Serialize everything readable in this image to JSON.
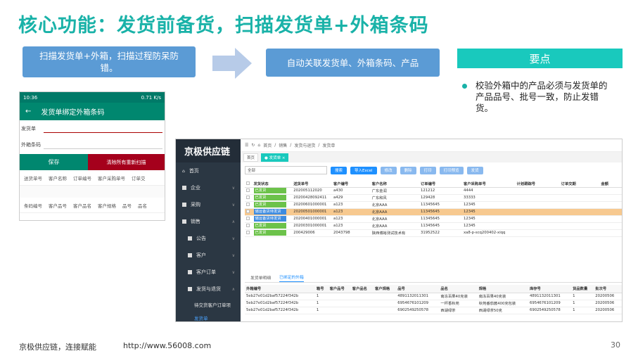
{
  "slide": {
    "title": "核心功能：发货前备货，扫描发货单+外箱条码",
    "step1": "扫描发货单+外箱，扫描过程防呆防错。",
    "step2": "自动关联发货单、外箱条码、产品",
    "key_title": "要点",
    "key_point": "校验外箱中的产品必须与发货单的产品品号、批号一致，防止发错货。",
    "footer_left": "京极供应链，连接赋能",
    "footer_url": "http://www.56008.com",
    "page_number": "30",
    "colors": {
      "accent": "#19b2a8",
      "box": "#5b9bd5",
      "key": "#19c9bd"
    }
  },
  "phone": {
    "status_time": "10:36",
    "status_right": "0.71 K/s",
    "title": "发货单绑定外箱条码",
    "back_icon": "back-arrow-icon",
    "field1_label": "发货单",
    "field2_label": "外箱条码",
    "save_label": "保存",
    "clear_label": "清除所有重新扫描",
    "head1": [
      "送货单号",
      "客户名称",
      "订单编号",
      "客户采购单号",
      "订单交"
    ],
    "head2": [
      "条码编号",
      "客户品号",
      "客户品名",
      "客户规格",
      "品号",
      "品名"
    ]
  },
  "app": {
    "brand": "京极供应链",
    "menu": {
      "home": "首页",
      "company": "企业",
      "purchase": "采购",
      "sales": "销售",
      "notice": "公告",
      "customer": "客户",
      "customer_order": "客户订单",
      "ship_return": "发货与退货",
      "pending": "待交货客户订单项",
      "ship_order": "发货单"
    },
    "breadcrumb": [
      "首页",
      "销售",
      "发货与退货",
      "发货单"
    ],
    "tabs": {
      "home": "首页",
      "current": "发货单"
    },
    "filter_value": "全部",
    "buttons": [
      "搜索",
      "导入Excel",
      "修改",
      "删除",
      "打印",
      "打印预览",
      "发货"
    ],
    "columns": [
      "发货状态",
      "送货单号",
      "客户编号",
      "客户名称",
      "订单编号",
      "客户采购单号",
      "计划跟踪号",
      "订单交期",
      "金额"
    ],
    "rows": [
      {
        "status": "已发货",
        "no": "20200511202​0",
        "cust": "a430",
        "name": "广东金润",
        "order": "121212",
        "po": "4444",
        "hl": false,
        "blue": false
      },
      {
        "status": "已发货",
        "no": "20200428092411",
        "cust": "a429",
        "name": "广东和风",
        "order": "129428",
        "po": "33333",
        "hl": false,
        "blue": false
      },
      {
        "status": "已发货",
        "no": "20200601000001",
        "cust": "a123",
        "name": "北京AAA",
        "order": "11345645",
        "po": "12345",
        "hl": false,
        "blue": false
      },
      {
        "status": "储运备货待发货",
        "no": "20200501000001",
        "cust": "a123",
        "name": "北京AAA",
        "order": "11345645",
        "po": "12345",
        "hl": true,
        "blue": true
      },
      {
        "status": "储运备货待发货",
        "no": "20200401000001",
        "cust": "a123",
        "name": "北京AAA",
        "order": "11345645",
        "po": "12345",
        "hl": false,
        "blue": true
      },
      {
        "status": "已发货",
        "no": "20200301000001",
        "cust": "a123",
        "name": "北京AAA",
        "order": "11345645",
        "po": "12345",
        "hl": false,
        "blue": false
      },
      {
        "status": "已发货",
        "no": "200429006",
        "cust": "2043798",
        "name": "陕西博裕测试技术有",
        "order": "31952522",
        "po": "xa8-p-scq200402-xiqq",
        "hl": false,
        "blue": false
      }
    ],
    "bottom_tabs": [
      "发货单明细",
      "已绑定的外箱"
    ],
    "bottom_columns": [
      "外箱编号",
      "箱号",
      "客户品号",
      "客户品名",
      "客户规格",
      "品号",
      "品名",
      "规格",
      "库存号",
      "货品数量",
      "批次号"
    ],
    "bottom_rows": [
      [
        "5eb27e01d2baf5722​4f342b",
        "1",
        "",
        "",
        "",
        "4891132011301",
        "南冻百果40克装",
        "南冻百果40克装",
        "4891132011301",
        "1",
        "20200506"
      ],
      [
        "5eb27e01d2baf57224f342b",
        "1",
        "",
        "",
        "",
        "6954676101209",
        "一杯香秋苑",
        "秋苑番茄酱400克包装",
        "6954676101209",
        "1",
        "20200506"
      ],
      [
        "5eb27e01d2baf57224f342b",
        "1",
        "",
        "",
        "",
        "6902549250578",
        "西湖绿茶",
        "西湖绿茶50克",
        "6902549250578",
        "1",
        "20200506"
      ]
    ]
  }
}
